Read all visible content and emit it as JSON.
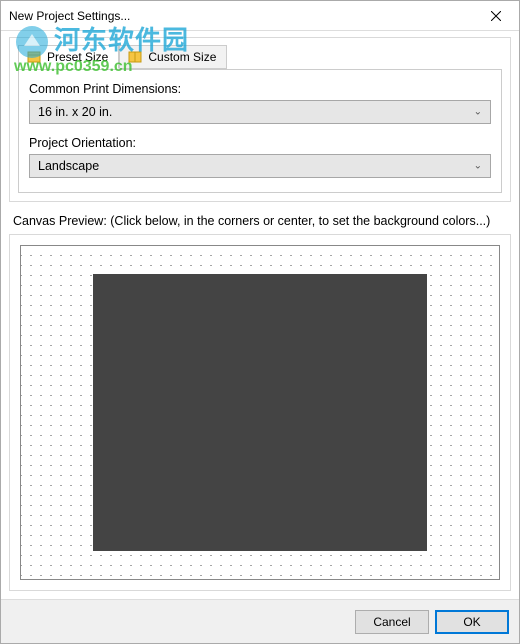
{
  "window": {
    "title": "New Project Settings..."
  },
  "tabs": {
    "preset": "Preset Size",
    "custom": "Custom Size"
  },
  "form": {
    "dimensions_label": "Common Print Dimensions:",
    "dimensions_value": "16 in. x 20 in.",
    "orientation_label": "Project Orientation:",
    "orientation_value": "Landscape"
  },
  "preview": {
    "label": "Canvas Preview: (Click below, in the corners or center, to set the background colors...)"
  },
  "buttons": {
    "cancel": "Cancel",
    "ok": "OK"
  },
  "watermark": {
    "line1": "河东软件园",
    "line2": "www.pc0359.cn"
  }
}
